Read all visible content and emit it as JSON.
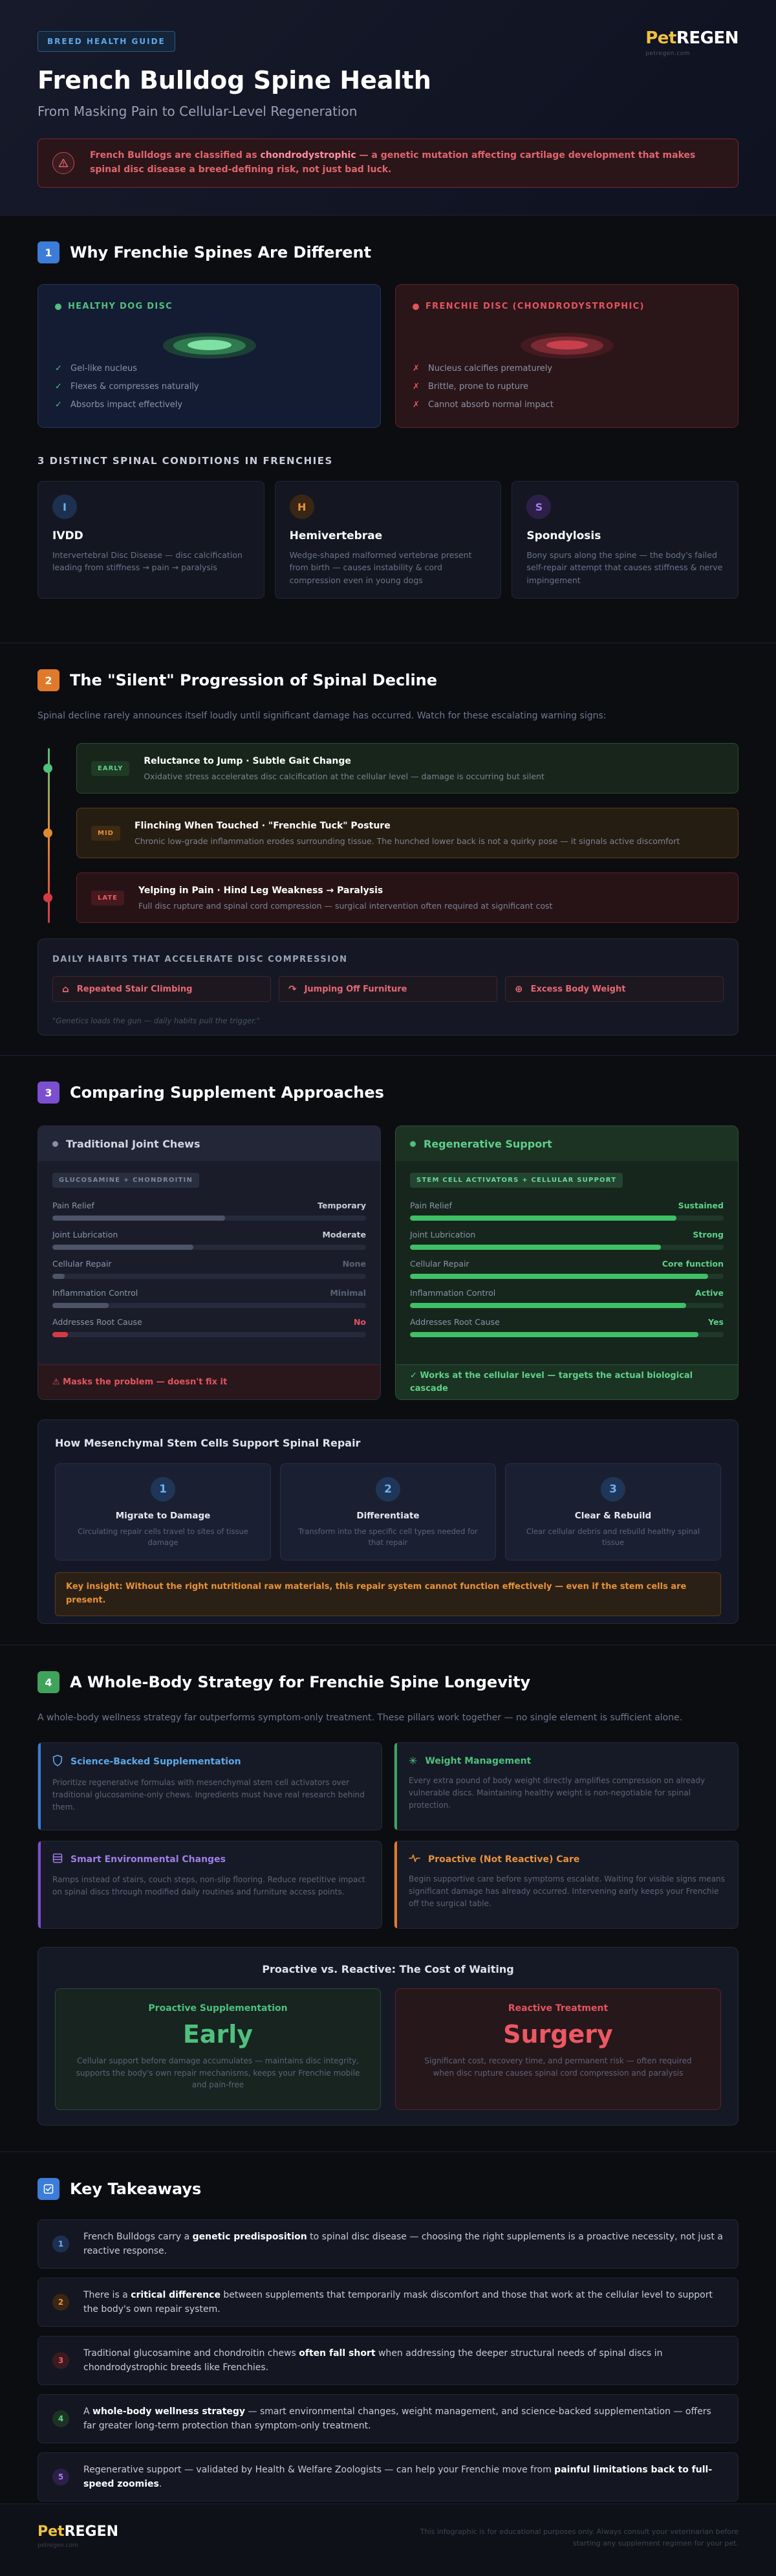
{
  "header": {
    "badge": "BREED HEALTH GUIDE",
    "logo_a": "Pet",
    "logo_b": "REGEN",
    "logo_sub": "petregen.com",
    "title": "French Bulldog Spine Health",
    "subtitle": "From Masking Pain to Cellular-Level Regeneration",
    "alert_pre": "French Bulldogs are classified as ",
    "alert_hl": "chondrodystrophic",
    "alert_post": " — a genetic mutation affecting cartilage development that makes spinal disc disease a breed-defining risk, not just bad luck."
  },
  "s1": {
    "num": "1",
    "title": "Why Frenchie Spines Are Different",
    "healthy": {
      "label": "HEALTHY DOG DISC",
      "items": [
        "Gel-like nucleus",
        "Flexes & compresses naturally",
        "Absorbs impact effectively"
      ]
    },
    "frenchie": {
      "label": "FRENCHIE DISC (CHONDRODYSTROPHIC)",
      "items": [
        "Nucleus calcifies prematurely",
        "Brittle, prone to rupture",
        "Cannot absorb normal impact"
      ]
    },
    "conditions_heading": "3 DISTINCT SPINAL CONDITIONS IN FRENCHIES",
    "conditions": [
      {
        "letter": "I",
        "name": "IVDD",
        "desc": "Intervertebral Disc Disease — disc calcification leading from stiffness → pain → paralysis"
      },
      {
        "letter": "H",
        "name": "Hemivertebrae",
        "desc": "Wedge-shaped malformed vertebrae present from birth — causes instability & cord compression even in young dogs"
      },
      {
        "letter": "S",
        "name": "Spondylosis",
        "desc": "Bony spurs along the spine — the body's failed self-repair attempt that causes stiffness & nerve impingement"
      }
    ]
  },
  "s2": {
    "num": "2",
    "title": "The \"Silent\" Progression of Spinal Decline",
    "lead": "Spinal decline rarely announces itself loudly until significant damage has occurred. Watch for these escalating warning signs:",
    "stages": [
      {
        "tag": "EARLY",
        "title": "Reluctance to Jump · Subtle Gait Change",
        "desc": "Oxidative stress accelerates disc calcification at the cellular level — damage is occurring but silent"
      },
      {
        "tag": "MID",
        "title": "Flinching When Touched · \"Frenchie Tuck\" Posture",
        "desc": "Chronic low-grade inflammation erodes surrounding tissue. The hunched lower back is not a quirky pose — it signals active discomfort"
      },
      {
        "tag": "LATE",
        "title": "Yelping in Pain · Hind Leg Weakness → Paralysis",
        "desc": "Full disc rupture and spinal cord compression — surgical intervention often required at significant cost"
      }
    ],
    "habits_heading": "DAILY HABITS THAT ACCELERATE DISC COMPRESSION",
    "habits": [
      "Repeated Stair Climbing",
      "Jumping Off Furniture",
      "Excess Body Weight"
    ],
    "quote": "\"Genetics loads the gun — daily habits pull the trigger.\""
  },
  "s3": {
    "num": "3",
    "title": "Comparing Supplement Approaches",
    "trad": {
      "title": "Traditional Joint Chews",
      "pill": "GLUCOSAMINE + CHONDROITIN",
      "metrics": [
        {
          "label": "Pain Relief",
          "value": "Temporary",
          "level": 0.55
        },
        {
          "label": "Joint Lubrication",
          "value": "Moderate",
          "level": 0.45
        },
        {
          "label": "Cellular Repair",
          "value": "None",
          "level": 0.04
        },
        {
          "label": "Inflammation Control",
          "value": "Minimal",
          "level": 0.18
        },
        {
          "label": "Addresses Root Cause",
          "value": "No",
          "level": 0.05
        }
      ],
      "foot": "⚠ Masks the problem — doesn't fix it"
    },
    "regen": {
      "title": "Regenerative Support",
      "pill": "STEM CELL ACTIVATORS + CELLULAR SUPPORT",
      "metrics": [
        {
          "label": "Pain Relief",
          "value": "Sustained",
          "level": 0.85
        },
        {
          "label": "Joint Lubrication",
          "value": "Strong",
          "level": 0.8
        },
        {
          "label": "Cellular Repair",
          "value": "Core function",
          "level": 0.95
        },
        {
          "label": "Inflammation Control",
          "value": "Active",
          "level": 0.88
        },
        {
          "label": "Addresses Root Cause",
          "value": "Yes",
          "level": 0.92
        }
      ],
      "foot": "✓ Works at the cellular level — targets the actual biological cascade"
    },
    "msc_title": "How Mesenchymal Stem Cells Support Spinal Repair",
    "steps": [
      {
        "n": "1",
        "title": "Migrate to Damage",
        "desc": "Circulating repair cells travel to sites of tissue damage"
      },
      {
        "n": "2",
        "title": "Differentiate",
        "desc": "Transform into the specific cell types needed for that repair"
      },
      {
        "n": "3",
        "title": "Clear & Rebuild",
        "desc": "Clear cellular debris and rebuild healthy spinal tissue"
      }
    ],
    "insight": "Key insight: Without the right nutritional raw materials, this repair system cannot function effectively — even if the stem cells are present."
  },
  "s4": {
    "num": "4",
    "title": "A Whole-Body Strategy for Frenchie Spine Longevity",
    "lead": "A whole-body wellness strategy far outperforms symptom-only treatment. These pillars work together — no single element is sufficient alone.",
    "pillars": [
      {
        "title": "Science-Backed Supplementation",
        "desc": "Prioritize regenerative formulas with mesenchymal stem cell activators over traditional glucosamine-only chews. Ingredients must have real research behind them."
      },
      {
        "title": "Weight Management",
        "desc": "Every extra pound of body weight directly amplifies compression on already vulnerable discs. Maintaining healthy weight is non-negotiable for spinal protection."
      },
      {
        "title": "Smart Environmental Changes",
        "desc": "Ramps instead of stairs, couch steps, non-slip flooring. Reduce repetitive impact on spinal discs through modified daily routines and furniture access points."
      },
      {
        "title": "Proactive (Not Reactive) Care",
        "desc": "Begin supportive care before symptoms escalate. Waiting for visible signs means significant damage has already occurred. Intervening early keeps your Frenchie off the surgical table."
      }
    ],
    "pvr_title": "Proactive vs. Reactive: The Cost of Waiting",
    "pro": {
      "label": "Proactive Supplementation",
      "big": "Early",
      "desc": "Cellular support before damage accumulates — maintains disc integrity, supports the body's own repair mechanisms, keeps your Frenchie mobile and pain-free"
    },
    "rea": {
      "label": "Reactive Treatment",
      "big": "Surgery",
      "desc": "Significant cost, recovery time, and permanent risk — often required when disc rupture causes spinal cord compression and paralysis"
    }
  },
  "s5": {
    "title": "Key Takeaways",
    "items": [
      {
        "n": "1",
        "pre": "French Bulldogs carry a ",
        "b": "genetic predisposition",
        "post": " to spinal disc disease — choosing the right supplements is a proactive necessity, not just a reactive response."
      },
      {
        "n": "2",
        "pre": "There is a ",
        "b": "critical difference",
        "post": " between supplements that temporarily mask discomfort and those that work at the cellular level to support the body's own repair system."
      },
      {
        "n": "3",
        "pre": "Traditional glucosamine and chondroitin chews ",
        "b": "often fall short",
        "post": " when addressing the deeper structural needs of spinal discs in chondrodystrophic breeds like Frenchies."
      },
      {
        "n": "4",
        "pre": "A ",
        "b": "whole-body wellness strategy",
        "post": " — smart environmental changes, weight management, and science-backed supplementation — offers far greater long-term protection than symptom-only treatment."
      },
      {
        "n": "5",
        "pre": "Regenerative support — validated by Health & Welfare Zoologists — can help your Frenchie move from ",
        "b": "painful limitations back to full-speed zoomies",
        "post": "."
      }
    ]
  },
  "footer": {
    "logo_a": "Pet",
    "logo_b": "REGEN",
    "logo_sub": "petregen.com",
    "disclaimer": "This infographic is for educational purposes only. Always consult your veterinarian before starting any supplement regimen for your pet."
  },
  "colors": {
    "blue": "#3b7dd8",
    "orange": "#e07a2a",
    "purple": "#7b4fd0",
    "green": "#3fa35c",
    "green_text": "#4fc07d",
    "red": "#e2545e",
    "gold": "#f0c040"
  }
}
